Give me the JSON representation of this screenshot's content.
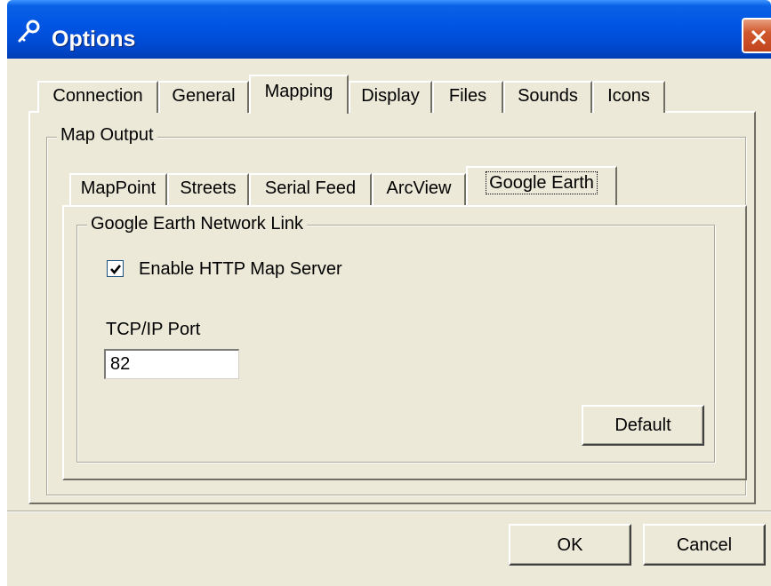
{
  "window": {
    "title": "Options",
    "icon": "key-icon",
    "close_icon": "close-icon",
    "titlebar_color": "#0054e3"
  },
  "tabs": [
    {
      "label": "Connection",
      "active": false
    },
    {
      "label": "General",
      "active": false
    },
    {
      "label": "Mapping",
      "active": true
    },
    {
      "label": "Display",
      "active": false
    },
    {
      "label": "Files",
      "active": false
    },
    {
      "label": "Sounds",
      "active": false
    },
    {
      "label": "Icons",
      "active": false
    }
  ],
  "map_output": {
    "group_label": "Map Output",
    "tabs": [
      {
        "label": "MapPoint",
        "active": false
      },
      {
        "label": "Streets",
        "active": false
      },
      {
        "label": "Serial Feed",
        "active": false
      },
      {
        "label": "ArcView",
        "active": false
      },
      {
        "label": "Google Earth",
        "active": true
      }
    ]
  },
  "google_earth": {
    "group_label": "Google Earth Network Link",
    "enable_checkbox": {
      "label": "Enable HTTP Map Server",
      "checked": true
    },
    "port_label": "TCP/IP Port",
    "port_value": "82",
    "default_button": "Default"
  },
  "footer": {
    "ok_button": "OK",
    "cancel_button": "Cancel"
  }
}
